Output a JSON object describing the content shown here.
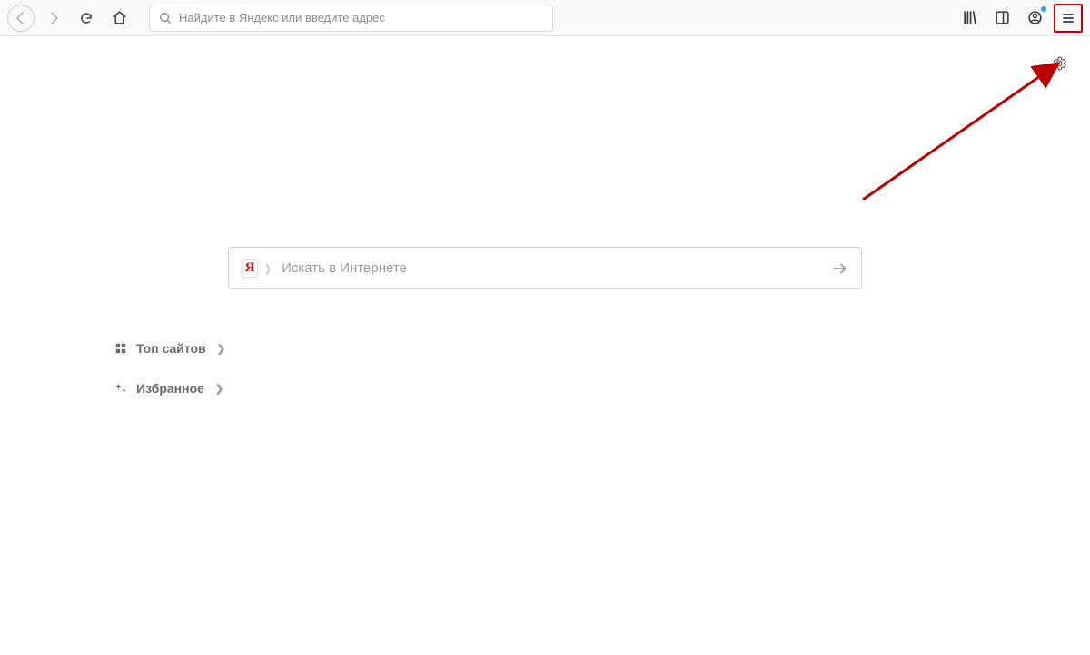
{
  "toolbar": {
    "url_placeholder": "Найдите в Яндекс или введите адрес"
  },
  "search": {
    "placeholder": "Искать в Интернете",
    "logo_letter": "Я"
  },
  "sections": {
    "top_sites": "Топ сайтов",
    "favorites": "Избранное"
  }
}
